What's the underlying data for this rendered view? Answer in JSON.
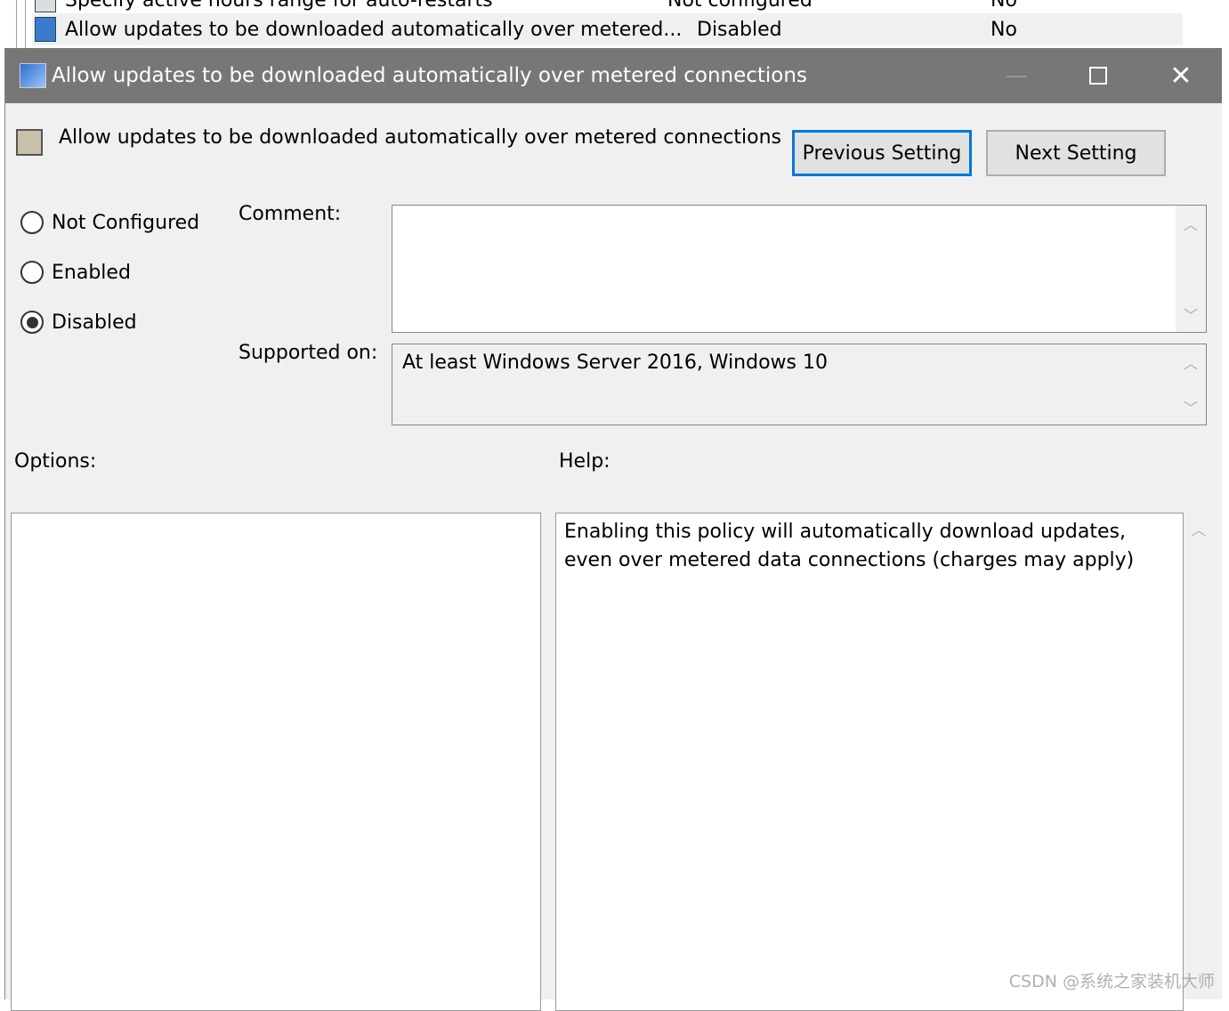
{
  "list": {
    "rows": [
      {
        "name": "Specify active hours range for auto-restarts",
        "state": "Not configured",
        "comment": "No"
      },
      {
        "name": "Allow updates to be downloaded automatically over metered...",
        "state": "Disabled",
        "comment": "No"
      }
    ]
  },
  "dialog": {
    "title": "Allow updates to be downloaded automatically over metered connections",
    "setting_name": "Allow updates to be downloaded automatically over metered connections",
    "prev_label": "Previous Setting",
    "next_label": "Next Setting",
    "radios": [
      {
        "label": "Not Configured",
        "checked": false
      },
      {
        "label": "Enabled",
        "checked": false
      },
      {
        "label": "Disabled",
        "checked": true
      }
    ],
    "comment_label": "Comment:",
    "comment_value": "",
    "supported_label": "Supported on:",
    "supported_value": "At least Windows Server 2016, Windows 10",
    "options_label": "Options:",
    "help_label": "Help:",
    "help_text": "Enabling this policy will automatically download updates, even over metered data connections (charges may apply)"
  },
  "watermark": "CSDN @系统之家装机大师"
}
